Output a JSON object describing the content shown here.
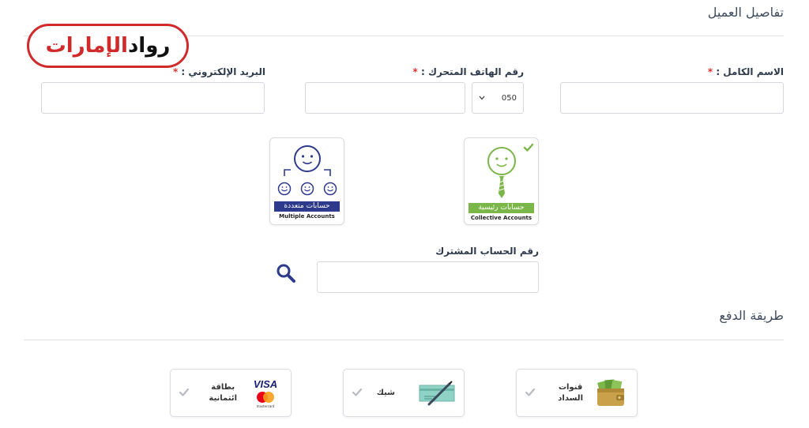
{
  "logo": {
    "text_black": "رواد",
    "text_red": "الإمارات"
  },
  "customer_section": {
    "title": "تفاصيل العميل"
  },
  "fields": {
    "full_name": {
      "label": "الاسم الكامل :",
      "required": "*",
      "value": ""
    },
    "mobile": {
      "label": "رقم الهاتف المتحرك :",
      "required": "*",
      "value": "",
      "prefix": "050"
    },
    "email": {
      "label": "البريد الإلكتروني :",
      "required": "*",
      "value": ""
    }
  },
  "account_types": [
    {
      "label_ar": "حسابات رئيسية",
      "label_en": "Collective Accounts",
      "selected": true,
      "color": "#7ab648"
    },
    {
      "label_ar": "حسابات متعددة",
      "label_en": "Multiple Accounts",
      "selected": false,
      "color": "#2e3a8c"
    }
  ],
  "subscriber": {
    "label": "رقم الحساب المشترك",
    "value": ""
  },
  "payment_section": {
    "title": "طريقة الدفع"
  },
  "payment_methods": [
    {
      "label": "قنوات\nالسداد",
      "icon": "wallet-icon"
    },
    {
      "label": "شيك",
      "icon": "cheque-icon"
    },
    {
      "label": "بطاقة\nائتمانية",
      "icon": "visa-mastercard-icon",
      "brand": "VISA",
      "brand_sub": "mastercard"
    }
  ],
  "colors": {
    "accent_green": "#7ab648",
    "accent_navy": "#2e3a8c",
    "required_red": "#e0322f",
    "logo_red": "#d12a2a"
  }
}
